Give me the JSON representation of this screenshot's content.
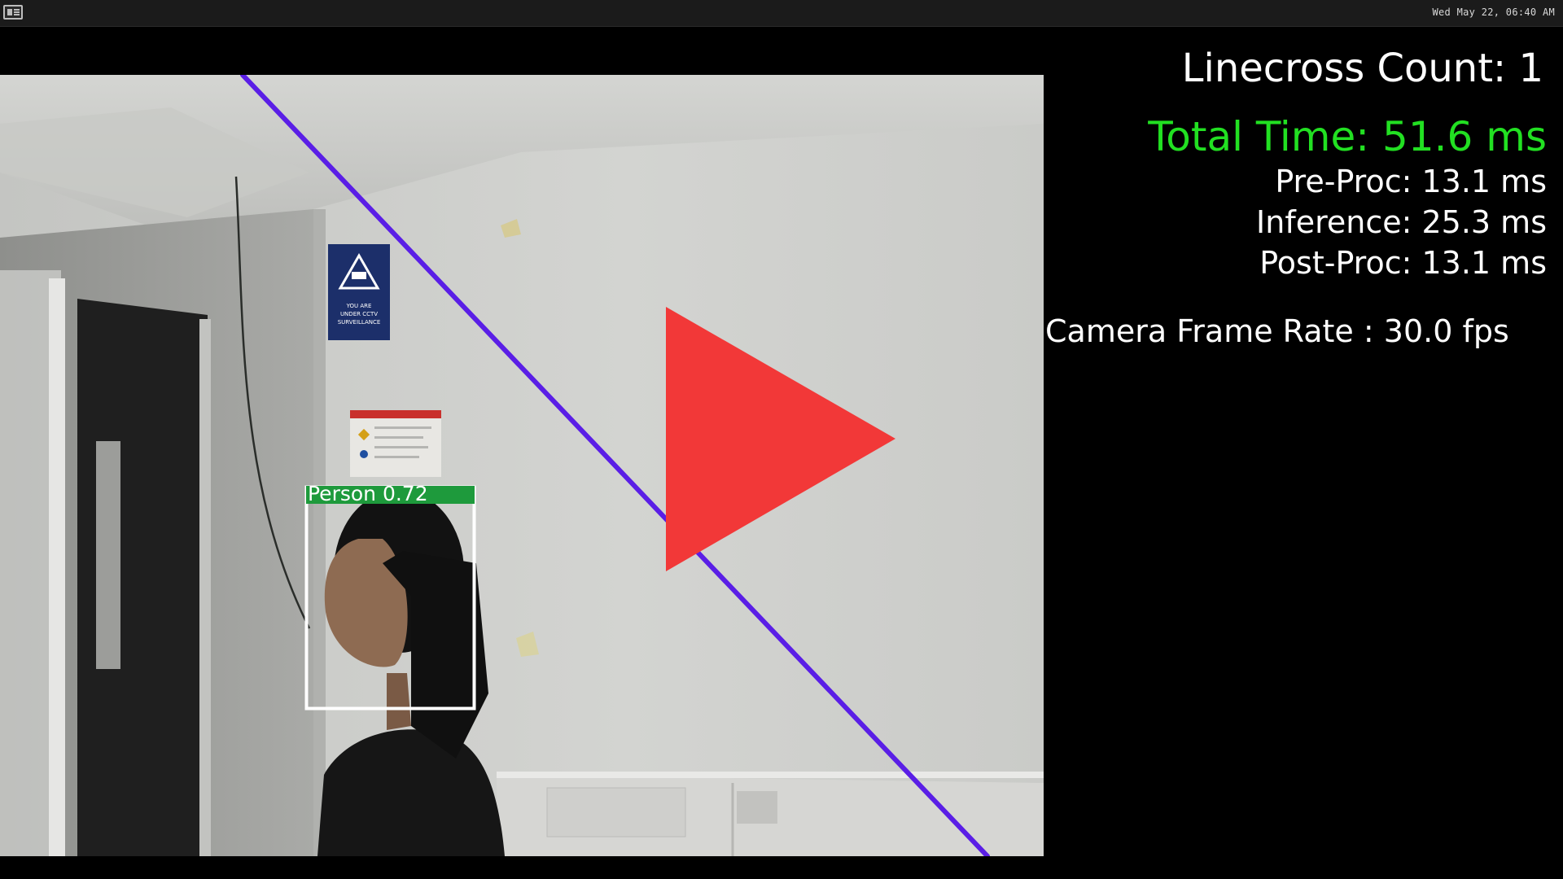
{
  "topbar": {
    "clock": "Wed May 22, 06:40 AM",
    "app_icon": "terminal-window-icon"
  },
  "video": {
    "detection": {
      "label": "Person 0.72",
      "box_color": "#ffffff",
      "label_bg": "#1e9a3c"
    },
    "line_color": "#5a1ee6",
    "sign_text": [
      "YOU ARE",
      "UNDER CCTV",
      "SURVEILLANCE"
    ],
    "play_icon": "play-icon",
    "play_color": "#f23838"
  },
  "stats": {
    "linecross": "Linecross Count: 1",
    "total_time": "Total Time: 51.6 ms",
    "pre_proc": "Pre-Proc: 13.1 ms",
    "inference": "Inference: 25.3 ms",
    "post_proc": "Post-Proc: 13.1 ms",
    "fps": "Camera Frame Rate : 30.0 fps",
    "accent_green": "#22e022"
  }
}
